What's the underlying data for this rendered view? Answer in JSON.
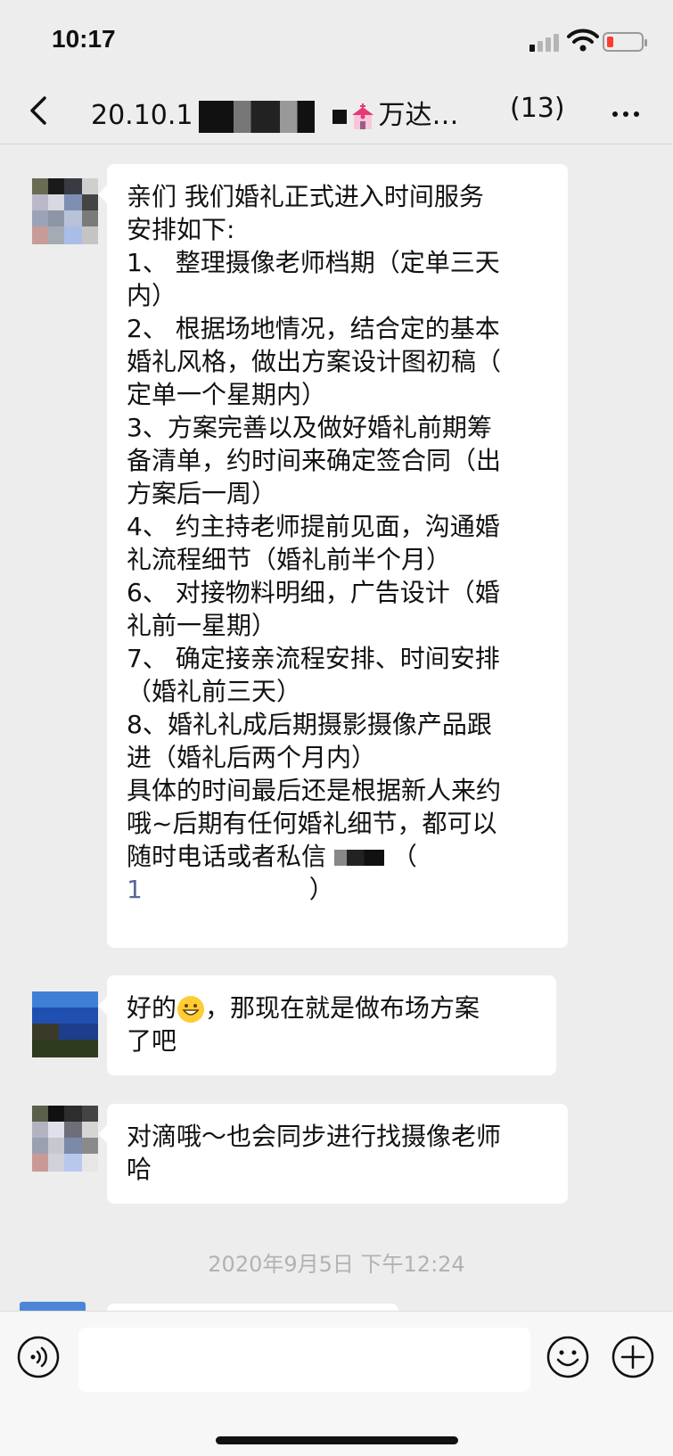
{
  "status": {
    "time": "10:17"
  },
  "nav": {
    "title_left": "20.10.1",
    "title_right": "万达…",
    "member_count": "(13)"
  },
  "messages": [
    {
      "text": "亲们 我们婚礼正式进入时间服务\n安排如下:\n1、 整理摄像老师档期（定单三天\n内）\n2、 根据场地情况，结合定的基本\n婚礼风格，做出方案设计图初稿（\n定单一个星期内）\n3、方案完善以及做好婚礼前期筹\n备清单，约时间来确定签合同（出\n方案后一周）\n4、 约主持老师提前见面，沟通婚\n礼流程细节（婚礼前半个月）\n6、 对接物料明细，广告设计（婚\n礼前一星期）\n7、 确定接亲流程安排、时间安排\n（婚礼前三天）\n8、婚礼礼成后期摄影摄像产品跟\n进（婚礼后两个月内）\n具体的时间最后还是根据新人来约\n哦~后期有任何婚礼细节，都可以\n随时电话或者私信",
      "paren_open": "（",
      "phone_prefix": "1",
      "paren_close": "）"
    },
    {
      "text_before": "好的",
      "text_after": "，那现在就是做布场方案\n了吧"
    },
    {
      "text": "对滴哦～也会同步进行找摄像老师\n哈"
    }
  ],
  "timestamp": "2020年9月5日 下午12:24",
  "icons": [
    "back-icon",
    "more-icon",
    "voice-icon",
    "emoji-icon",
    "plus-icon",
    "wifi-icon",
    "battery-icon",
    "signal-icon"
  ],
  "colors": {
    "background": "#ededed",
    "bubble": "#ffffff",
    "link": "#576b95",
    "timestamp": "#b2b2b2"
  }
}
